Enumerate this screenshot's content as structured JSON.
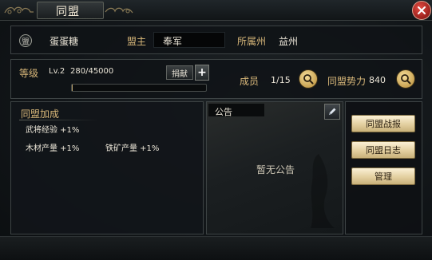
{
  "header": {
    "title": "同盟",
    "close_icon": "close-icon"
  },
  "info": {
    "seal_glyph": "盟",
    "alliance_name": "蛋蛋糖",
    "leader_label": "盟主",
    "leader_name": "奉军",
    "state_label": "所属州",
    "state_value": "益州"
  },
  "level": {
    "label": "等级",
    "value": "Lv.2",
    "exp_text": "280/45000",
    "exp_progress": 0.0062,
    "donate_label": "捐献",
    "plus_label": "+"
  },
  "stats": {
    "members_label": "成员",
    "members_value": "1/15",
    "power_label": "同盟势力",
    "power_value": "840"
  },
  "bonus": {
    "title": "同盟加成",
    "items": [
      "武将经验 +1%",
      "木材产量 +1%",
      "铁矿产量 +1%"
    ]
  },
  "notice": {
    "title": "公告",
    "empty_text": "暂无公告"
  },
  "actions": {
    "battle_report": "同盟战报",
    "log": "同盟日志",
    "manage": "管理"
  },
  "colors": {
    "accent_gold": "#d9b87a",
    "button_gold": "#e3cfa0",
    "close_red": "#b8261f"
  }
}
